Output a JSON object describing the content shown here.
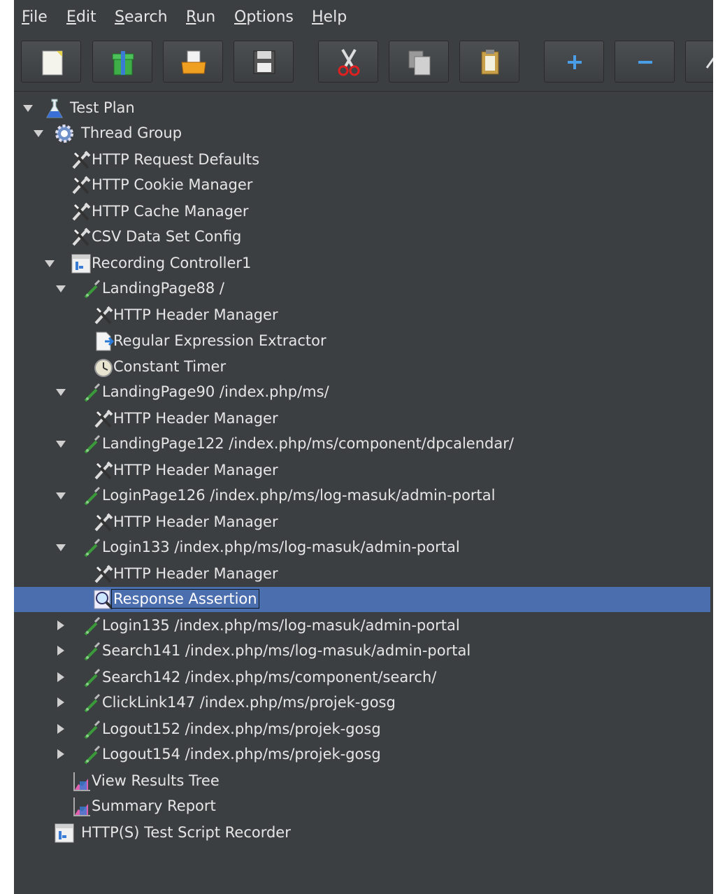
{
  "menu": {
    "items": [
      {
        "pre": "",
        "mn": "F",
        "post": "ile"
      },
      {
        "pre": "",
        "mn": "E",
        "post": "dit"
      },
      {
        "pre": "",
        "mn": "S",
        "post": "earch"
      },
      {
        "pre": "",
        "mn": "R",
        "post": "un"
      },
      {
        "pre": "",
        "mn": "O",
        "post": "ptions"
      },
      {
        "pre": "",
        "mn": "H",
        "post": "elp"
      }
    ]
  },
  "toolbar": {
    "buttons": [
      "new-icon",
      "templates-icon",
      "open-icon",
      "save-icon",
      "cut-icon",
      "copy-icon",
      "paste-icon",
      "expand-icon",
      "collapse-icon",
      "toggle-icon"
    ]
  },
  "tree": {
    "nodes": [
      {
        "label": "Test Plan",
        "icon": "flask-icon",
        "toggle": "expanded"
      },
      {
        "label": "Thread Group",
        "icon": "gear-icon",
        "toggle": "expanded"
      },
      {
        "label": "HTTP Request Defaults",
        "icon": "config-icon",
        "toggle": "none"
      },
      {
        "label": "HTTP Cookie Manager",
        "icon": "config-icon",
        "toggle": "none"
      },
      {
        "label": "HTTP Cache Manager",
        "icon": "config-icon",
        "toggle": "none"
      },
      {
        "label": "CSV Data Set Config",
        "icon": "config-icon",
        "toggle": "none"
      },
      {
        "label": "Recording Controller1",
        "icon": "controller-icon",
        "toggle": "expanded"
      },
      {
        "label": "LandingPage88 /",
        "icon": "sampler-icon",
        "toggle": "expanded"
      },
      {
        "label": "HTTP Header Manager",
        "icon": "config-icon",
        "toggle": "none"
      },
      {
        "label": "Regular Expression Extractor",
        "icon": "extractor-icon",
        "toggle": "none"
      },
      {
        "label": "Constant Timer",
        "icon": "timer-icon",
        "toggle": "none"
      },
      {
        "label": "LandingPage90 /index.php/ms/",
        "icon": "sampler-icon",
        "toggle": "expanded"
      },
      {
        "label": "HTTP Header Manager",
        "icon": "config-icon",
        "toggle": "none"
      },
      {
        "label": "LandingPage122 /index.php/ms/component/dpcalendar/",
        "icon": "sampler-icon",
        "toggle": "expanded"
      },
      {
        "label": "HTTP Header Manager",
        "icon": "config-icon",
        "toggle": "none"
      },
      {
        "label": "LoginPage126 /index.php/ms/log-masuk/admin-portal",
        "icon": "sampler-icon",
        "toggle": "expanded"
      },
      {
        "label": "HTTP Header Manager",
        "icon": "config-icon",
        "toggle": "none"
      },
      {
        "label": "Login133 /index.php/ms/log-masuk/admin-portal",
        "icon": "sampler-icon",
        "toggle": "expanded"
      },
      {
        "label": "HTTP Header Manager",
        "icon": "config-icon",
        "toggle": "none"
      },
      {
        "label": "Response Assertion",
        "icon": "assertion-icon",
        "toggle": "none",
        "selected": true
      },
      {
        "label": "Login135 /index.php/ms/log-masuk/admin-portal",
        "icon": "sampler-icon",
        "toggle": "collapsed"
      },
      {
        "label": "Search141 /index.php/ms/log-masuk/admin-portal",
        "icon": "sampler-icon",
        "toggle": "collapsed"
      },
      {
        "label": "Search142 /index.php/ms/component/search/",
        "icon": "sampler-icon",
        "toggle": "collapsed"
      },
      {
        "label": "ClickLink147 /index.php/ms/projek-gosg",
        "icon": "sampler-icon",
        "toggle": "collapsed"
      },
      {
        "label": "Logout152 /index.php/ms/projek-gosg",
        "icon": "sampler-icon",
        "toggle": "collapsed"
      },
      {
        "label": "Logout154 /index.php/ms/projek-gosg",
        "icon": "sampler-icon",
        "toggle": "collapsed"
      },
      {
        "label": "View Results Tree",
        "icon": "listener-icon",
        "toggle": "none"
      },
      {
        "label": "Summary Report",
        "icon": "listener-icon",
        "toggle": "none"
      },
      {
        "label": "HTTP(S) Test Script Recorder",
        "icon": "recorder-icon",
        "toggle": "none"
      }
    ]
  },
  "colors": {
    "background": "#3c3f41",
    "selection": "#4b6eaf",
    "text": "#e6e6e6"
  }
}
